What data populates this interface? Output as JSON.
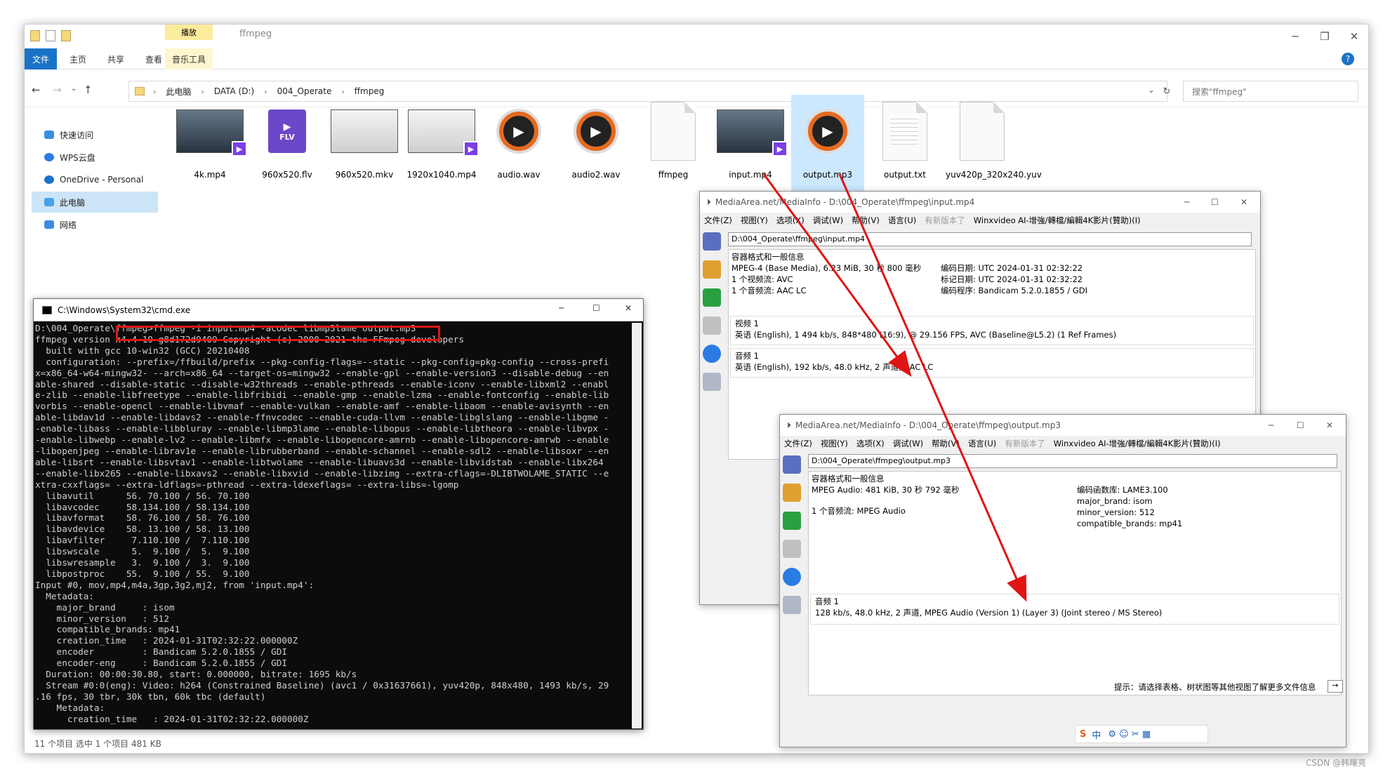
{
  "explorer": {
    "title": "ffmpeg",
    "tabs": [
      "文件",
      "主页",
      "共享",
      "查看",
      "音乐工具"
    ],
    "play_tab": "播放",
    "path": [
      "此电脑",
      "DATA (D:)",
      "004_Operate",
      "ffmpeg"
    ],
    "search_placeholder": "搜索\"ffmpeg\"",
    "nav": [
      "快速访问",
      "WPS云盘",
      "OneDrive - Personal",
      "此电脑",
      "网络"
    ],
    "files": [
      {
        "name": "4k.mp4",
        "kind": "video"
      },
      {
        "name": "960x520.flv",
        "kind": "flv"
      },
      {
        "name": "960x520.mkv",
        "kind": "video-light"
      },
      {
        "name": "1920x1040.mp4",
        "kind": "video-light"
      },
      {
        "name": "audio.wav",
        "kind": "audio"
      },
      {
        "name": "audio2.wav",
        "kind": "audio"
      },
      {
        "name": "ffmpeg",
        "kind": "doc"
      },
      {
        "name": "input.mp4",
        "kind": "video"
      },
      {
        "name": "output.mp3",
        "kind": "audio"
      },
      {
        "name": "output.txt",
        "kind": "text"
      },
      {
        "name": "yuv420p_320x240.yuv",
        "kind": "doc"
      }
    ],
    "status": "11 个项目    选中 1 个项目  481 KB"
  },
  "cmd": {
    "title": "C:\\Windows\\System32\\cmd.exe",
    "lines": [
      "D:\\004_Operate\\ffmpeg>ffmpeg -i input.mp4 -acodec libmp3lame output.mp3",
      "ffmpeg version n4.4-19-g8d172d9409 Copyright (c) 2000-2021 the FFmpeg developers",
      "  built with gcc 10-win32 (GCC) 20210408",
      "  configuration: --prefix=/ffbuild/prefix --pkg-config-flags=--static --pkg-config=pkg-config --cross-prefi",
      "x=x86_64-w64-mingw32- --arch=x86_64 --target-os=mingw32 --enable-gpl --enable-version3 --disable-debug --en",
      "able-shared --disable-static --disable-w32threads --enable-pthreads --enable-iconv --enable-libxml2 --enabl",
      "e-zlib --enable-libfreetype --enable-libfribidi --enable-gmp --enable-lzma --enable-fontconfig --enable-lib",
      "vorbis --enable-opencl --enable-libvmaf --enable-vulkan --enable-amf --enable-libaom --enable-avisynth --en",
      "able-libdav1d --enable-libdavs2 --enable-ffnvcodec --enable-cuda-llvm --enable-libglslang --enable-libgme -",
      "-enable-libass --enable-libbluray --enable-libmp3lame --enable-libopus --enable-libtheora --enable-libvpx -",
      "-enable-libwebp --enable-lv2 --enable-libmfx --enable-libopencore-amrnb --enable-libopencore-amrwb --enable",
      "-libopenjpeg --enable-librav1e --enable-librubberband --enable-schannel --enable-sdl2 --enable-libsoxr --en",
      "able-libsrt --enable-libsvtav1 --enable-libtwolame --enable-libuavs3d --enable-libvidstab --enable-libx264",
      "--enable-libx265 --enable-libxavs2 --enable-libxvid --enable-libzimg --extra-cflags=-DLIBTWOLAME_STATIC --e",
      "xtra-cxxflags= --extra-ldflags=-pthread --extra-ldexeflags= --extra-libs=-lgomp",
      "  libavutil      56. 70.100 / 56. 70.100",
      "  libavcodec     58.134.100 / 58.134.100",
      "  libavformat    58. 76.100 / 58. 76.100",
      "  libavdevice    58. 13.100 / 58. 13.100",
      "  libavfilter     7.110.100 /  7.110.100",
      "  libswscale      5.  9.100 /  5.  9.100",
      "  libswresample   3.  9.100 /  3.  9.100",
      "  libpostproc    55.  9.100 / 55.  9.100",
      "Input #0, mov,mp4,m4a,3gp,3g2,mj2, from 'input.mp4':",
      "  Metadata:",
      "    major_brand     : isom",
      "    minor_version   : 512",
      "    compatible_brands: mp41",
      "    creation_time   : 2024-01-31T02:32:22.000000Z",
      "    encoder         : Bandicam 5.2.0.1855 / GDI",
      "    encoder-eng     : Bandicam 5.2.0.1855 / GDI",
      "  Duration: 00:00:30.80, start: 0.000000, bitrate: 1695 kb/s",
      "  Stream #0:0(eng): Video: h264 (Constrained Baseline) (avc1 / 0x31637661), yuv420p, 848x480, 1493 kb/s, 29",
      ".16 fps, 30 tbr, 30k tbn, 60k tbc (default)",
      "    Metadata:",
      "      creation_time   : 2024-01-31T02:32:22.000000Z"
    ]
  },
  "mi1": {
    "title": "MediaArea.net/MediaInfo - D:\\004_Operate\\ffmpeg\\input.mp4",
    "menu": [
      "文件(Z)",
      "视图(Y)",
      "选项(X)",
      "调试(W)",
      "帮助(V)",
      "语言(U)",
      "有新版本了",
      "Winxvideo AI-增強/轉檔/編輯4K影片(贊助)(I)"
    ],
    "file": "D:\\004_Operate\\ffmpeg\\input.mp4",
    "general_head": "容器格式和一般信息",
    "general_l1": "MPEG-4 (Base Media), 6.23 MiB, 30 秒 800 毫秒",
    "general_l2": "1 个视频流: AVC",
    "general_l3": "1 个音频流: AAC LC",
    "general_r1": "编码日期: UTC 2024-01-31 02:32:22",
    "general_r2": "标记日期: UTC 2024-01-31 02:32:22",
    "general_r3": "编码程序: Bandicam 5.2.0.1855 / GDI",
    "video_head": "视频 1",
    "video_line": "英语 (English), 1 494 kb/s, 848*480 (16:9), @ 29.156 FPS, AVC (Baseline@L5.2) (1 Ref Frames)",
    "audio_head": "音频 1",
    "audio_line": "英语 (English), 192 kb/s, 48.0 kHz, 2 声道, AAC LC"
  },
  "mi2": {
    "title": "MediaArea.net/MediaInfo - D:\\004_Operate\\ffmpeg\\output.mp3",
    "menu": [
      "文件(Z)",
      "视图(Y)",
      "选项(X)",
      "调试(W)",
      "帮助(V)",
      "语言(U)",
      "有新版本了",
      "Winxvideo AI-增強/轉檔/編輯4K影片(贊助)(I)"
    ],
    "file": "D:\\004_Operate\\ffmpeg\\output.mp3",
    "general_head": "容器格式和一般信息",
    "general_l1": "MPEG Audio: 481 KiB, 30 秒 792 毫秒",
    "general_l2": "1 个音频流: MPEG Audio",
    "general_r1": "编码函数库: LAME3.100",
    "general_r2": "major_brand: isom",
    "general_r3": "minor_version: 512",
    "general_r4": "compatible_brands: mp41",
    "audio_head": "音频 1",
    "audio_line": "128 kb/s, 48.0 kHz, 2 声道, MPEG Audio (Version 1) (Layer 3) (Joint stereo / MS Stereo)",
    "hint": "提示：请选择表格、树状图等其他视图了解更多文件信息",
    "ime": "中"
  },
  "watermark": "CSDN @韩曙亮",
  "colors": {
    "arrow": "#e01515",
    "accent": "#1a73c8"
  }
}
